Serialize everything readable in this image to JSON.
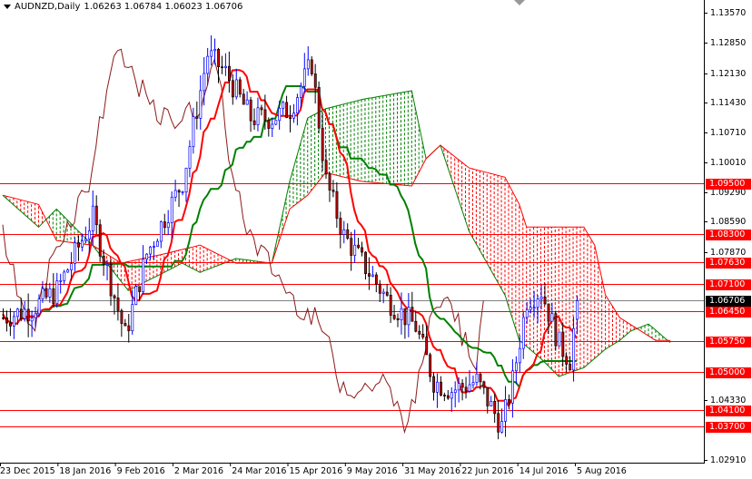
{
  "header": {
    "symbol_label": "AUDNZD,Daily",
    "ohlc": "1.06263 1.06784 1.06023 1.06706"
  },
  "colors": {
    "level": "#ff0000",
    "tenkan": "#ff0000",
    "kijun": "#008000",
    "chikou": "#8b1a1a",
    "bull": "#0000ff",
    "bear": "#cc0000",
    "cloud_up": "#008000",
    "cloud_down": "#ff0000",
    "current": "#808080"
  },
  "chart_data": {
    "type": "candlestick",
    "title": "AUDNZD,Daily",
    "ylim": [
      1.0291,
      1.1357
    ],
    "y_ticks": [
      "1.13570",
      "1.12850",
      "1.12130",
      "1.11430",
      "1.10710",
      "1.10010",
      "1.09290",
      "1.08590",
      "1.07870",
      "1.04330",
      "1.02910"
    ],
    "x_labels": [
      "23 Dec 2015",
      "18 Jan 2016",
      "9 Feb 2016",
      "2 Mar 2016",
      "24 Mar 2016",
      "15 Apr 2016",
      "9 May 2016",
      "31 May 2016",
      "22 Jun 2016",
      "14 Jul 2016",
      "5 Aug 2016"
    ],
    "close_keyframes": [
      [
        0,
        1.063
      ],
      [
        8,
        1.0652
      ],
      [
        15,
        1.0695
      ],
      [
        25,
        1.0868
      ],
      [
        34,
        1.0587
      ],
      [
        40,
        1.0782
      ],
      [
        50,
        1.0955
      ],
      [
        57,
        1.1258
      ],
      [
        62,
        1.1214
      ],
      [
        69,
        1.1106
      ],
      [
        75,
        1.1106
      ],
      [
        80,
        1.1128
      ],
      [
        86,
        1.1236
      ],
      [
        90,
        1.0955
      ],
      [
        95,
        1.0825
      ],
      [
        102,
        1.0738
      ],
      [
        107,
        1.0674
      ],
      [
        115,
        1.0609
      ],
      [
        120,
        1.0479
      ],
      [
        125,
        1.0457
      ],
      [
        132,
        1.0479
      ],
      [
        139,
        1.0371
      ],
      [
        142,
        1.0479
      ],
      [
        146,
        1.0674
      ],
      [
        150,
        1.0695
      ],
      [
        155,
        1.0566
      ],
      [
        158,
        1.053
      ],
      [
        160,
        1.06706
      ]
    ],
    "span_a_keyframes": [
      [
        0,
        1.0922
      ],
      [
        10,
        1.0846
      ],
      [
        15,
        1.0889
      ],
      [
        25,
        1.0803
      ],
      [
        35,
        1.0695
      ],
      [
        45,
        1.0738
      ],
      [
        50,
        1.076
      ],
      [
        55,
        1.0738
      ],
      [
        65,
        1.0771
      ],
      [
        75,
        1.076
      ],
      [
        80,
        1.0955
      ],
      [
        85,
        1.1106
      ],
      [
        90,
        1.1128
      ],
      [
        100,
        1.115
      ],
      [
        114,
        1.1171
      ],
      [
        118,
        1.1009
      ],
      [
        122,
        1.1041
      ],
      [
        130,
        1.0836
      ],
      [
        140,
        1.0684
      ],
      [
        144,
        1.0576
      ],
      [
        150,
        1.0533
      ],
      [
        155,
        1.049
      ],
      [
        162,
        1.0511
      ],
      [
        168,
        1.0555
      ],
      [
        172,
        1.0576
      ],
      [
        175,
        1.0598
      ],
      [
        180,
        1.0615
      ],
      [
        186,
        1.0571
      ]
    ],
    "span_b_keyframes": [
      [
        0,
        1.0922
      ],
      [
        10,
        1.09
      ],
      [
        15,
        1.0814
      ],
      [
        25,
        1.0803
      ],
      [
        33,
        1.076
      ],
      [
        45,
        1.0782
      ],
      [
        55,
        1.0803
      ],
      [
        65,
        1.076
      ],
      [
        75,
        1.076
      ],
      [
        80,
        1.0889
      ],
      [
        85,
        1.0922
      ],
      [
        90,
        1.0976
      ],
      [
        100,
        1.0955
      ],
      [
        114,
        1.0944
      ],
      [
        118,
        1.1009
      ],
      [
        122,
        1.1041
      ],
      [
        130,
        1.0987
      ],
      [
        140,
        1.0965
      ],
      [
        144,
        1.09
      ],
      [
        146,
        1.0846
      ],
      [
        162,
        1.0846
      ],
      [
        165,
        1.0803
      ],
      [
        168,
        1.0684
      ],
      [
        172,
        1.063
      ],
      [
        182,
        1.0576
      ],
      [
        186,
        1.0576
      ]
    ],
    "levels": [
      1.095,
      1.083,
      1.0763,
      1.071,
      1.0645,
      1.0575,
      1.05,
      1.041,
      1.037
    ],
    "level_labels": [
      "1.09500",
      "1.08300",
      "1.07630",
      "1.07100",
      "1.06450",
      "1.05750",
      "1.05000",
      "1.04100",
      "1.03700"
    ],
    "current_price": 1.06706,
    "current_label": "1.06706",
    "tenkan_period": 9,
    "kijun_period": 26,
    "chikou_shift": 26
  }
}
